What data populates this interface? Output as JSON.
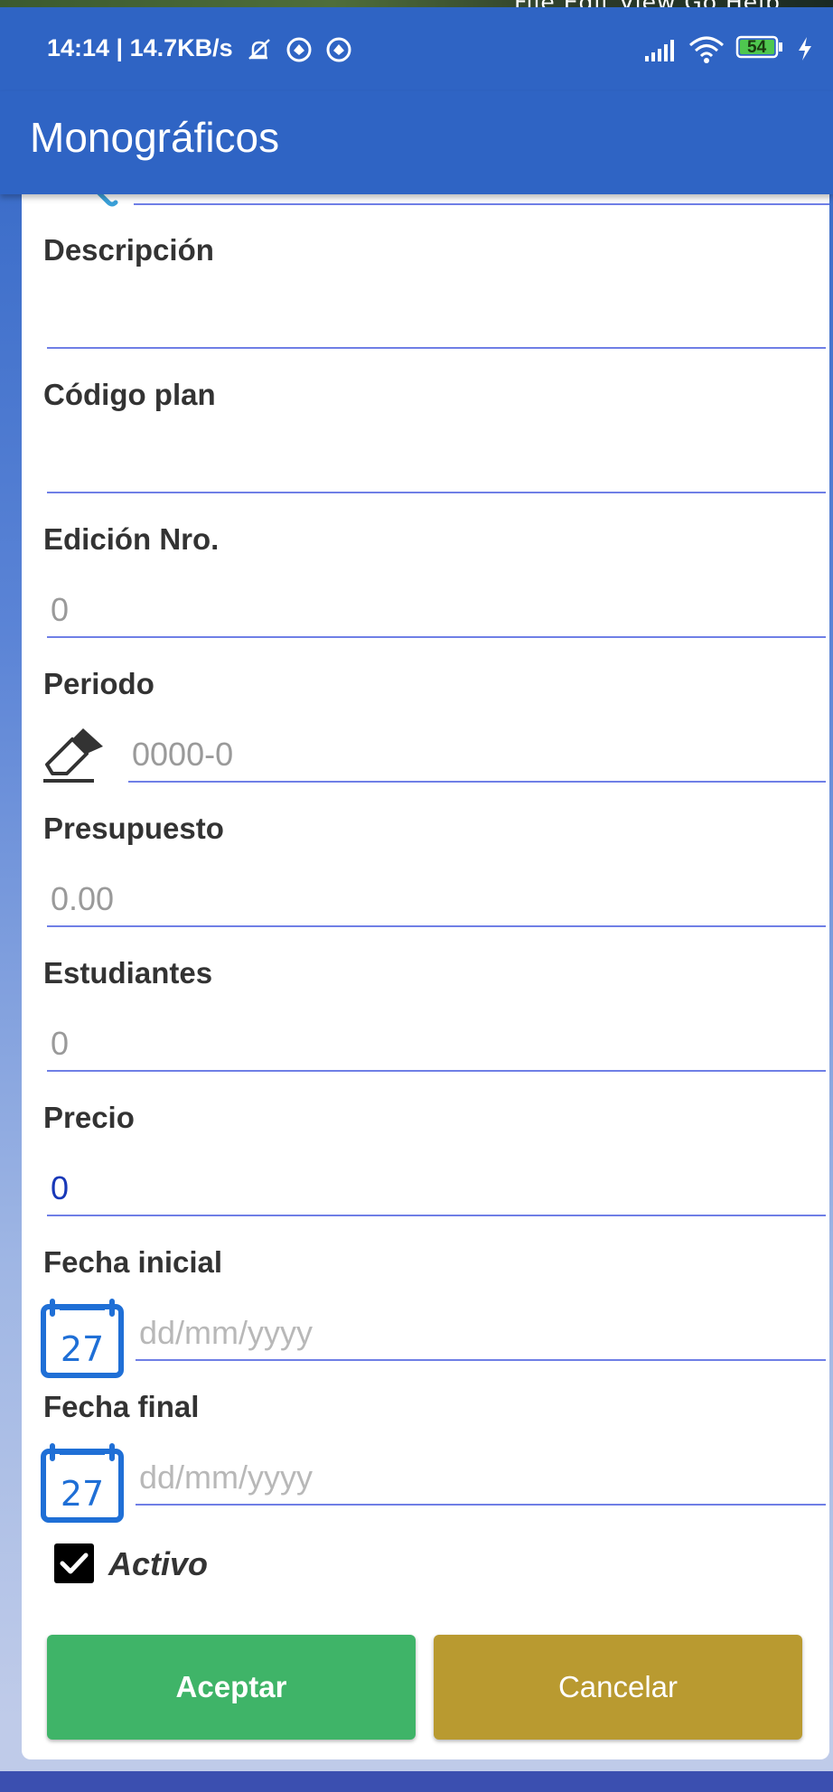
{
  "status": {
    "text": "14:14 | 14.7KB/s",
    "battery": "54"
  },
  "menu": "File  Edit  View  Go  Help",
  "app": {
    "title": "Monográficos"
  },
  "form": {
    "descripcion_label": "Descripción",
    "descripcion_value": "",
    "codigo_label": "Código plan",
    "codigo_value": "",
    "edicion_label": "Edición Nro.",
    "edicion_placeholder": "0",
    "periodo_label": "Periodo",
    "periodo_placeholder": "0000-0",
    "presupuesto_label": "Presupuesto",
    "presupuesto_placeholder": "0.00",
    "estudiantes_label": "Estudiantes",
    "estudiantes_placeholder": "0",
    "precio_label": "Precio",
    "precio_value": "0",
    "fecha_inicial_label": "Fecha inicial",
    "fecha_inicial_placeholder": "dd/mm/yyyy",
    "fecha_final_label": "Fecha final",
    "fecha_final_placeholder": "dd/mm/yyyy",
    "calendar_day": "27",
    "activo_label": "Activo",
    "activo_checked": true
  },
  "buttons": {
    "accept": "Aceptar",
    "cancel": "Cancelar"
  },
  "colors": {
    "primary": "#2f64c4",
    "accept": "#3fb468",
    "cancel": "#b99a30",
    "underline": "#6f7fe6",
    "calendar": "#1f6fd6"
  }
}
